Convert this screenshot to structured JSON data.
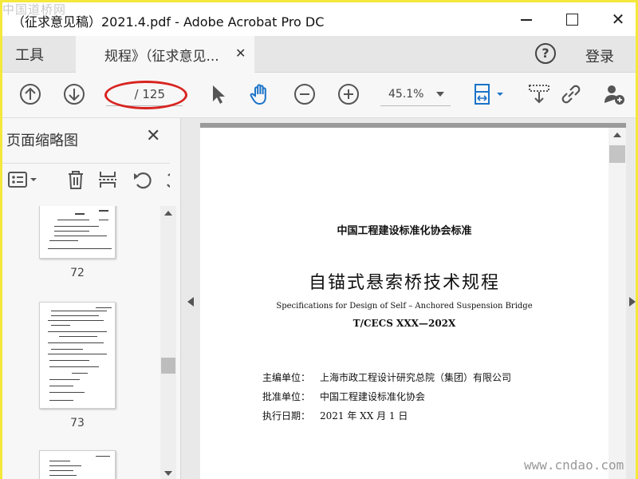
{
  "watermark_top": "中国道桥网",
  "watermark_bottom": "www.cndao.com",
  "window": {
    "title": "（征求意见稿）2021.4.pdf - Adobe Acrobat Pro DC",
    "min_icon": "minimize-icon",
    "max_icon": "maximize-icon",
    "close_glyph": "✕"
  },
  "tabs": {
    "tools_label": "工具",
    "doc_label": "规程》（征求意见...",
    "doc_close": "✕",
    "help_glyph": "?",
    "login_label": "登录"
  },
  "toolbar": {
    "page_display": "/ 125",
    "zoom_value": "45.1%",
    "highlight_color": "#d8231f",
    "accent_color": "#1a73c8"
  },
  "left_panel": {
    "title": "页面缩略图",
    "close_glyph": "✕",
    "thumbnails": [
      {
        "label": "72"
      },
      {
        "label": "73"
      },
      {
        "label": ""
      }
    ]
  },
  "document": {
    "org_standard": "中国工程建设标准化协会标准",
    "title_cn": "自锚式悬索桥技术规程",
    "title_en": "Specifications for Design of Self – Anchored Suspension Bridge",
    "code": "T/CECS XXX—202X",
    "meta": [
      {
        "key": "主编单位：",
        "value": "上海市政工程设计研究总院（集团）有限公司"
      },
      {
        "key": "批准单位：",
        "value": "中国工程建设标准化协会"
      },
      {
        "key": "执行日期：",
        "value": "2021 年 XX 月 1 日"
      }
    ]
  }
}
